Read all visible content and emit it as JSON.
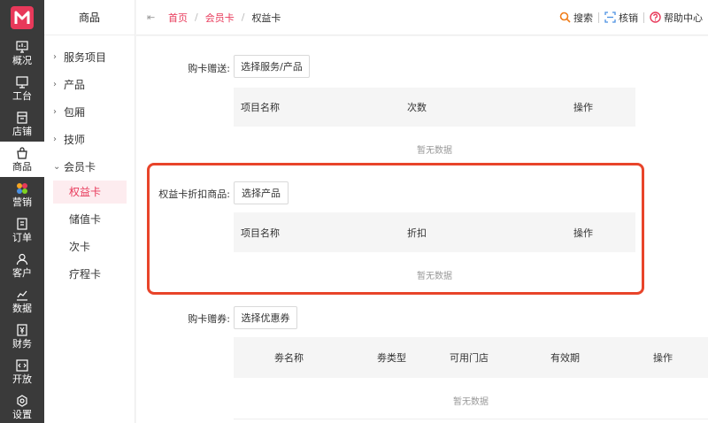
{
  "nav": {
    "items": [
      {
        "label": "概况",
        "icon": "monitor-chart-icon"
      },
      {
        "label": "工台",
        "icon": "desktop-icon"
      },
      {
        "label": "店铺",
        "icon": "store-icon"
      },
      {
        "label": "商品",
        "icon": "bag-icon"
      },
      {
        "label": "营销",
        "icon": "marketing-icon"
      },
      {
        "label": "订单",
        "icon": "order-icon"
      },
      {
        "label": "客户",
        "icon": "user-icon"
      },
      {
        "label": "数据",
        "icon": "data-icon"
      },
      {
        "label": "财务",
        "icon": "finance-icon"
      },
      {
        "label": "开放",
        "icon": "code-icon"
      },
      {
        "label": "设置",
        "icon": "settings-icon"
      }
    ]
  },
  "submenu": {
    "title": "商品",
    "groups": [
      "服务项目",
      "产品",
      "包厢",
      "技师",
      "会员卡"
    ],
    "leaves": [
      "权益卡",
      "储值卡",
      "次卡",
      "疗程卡"
    ]
  },
  "topbar": {
    "breadcrumb": [
      "首页",
      "会员卡",
      "权益卡"
    ],
    "search": "搜索",
    "verify": "核销",
    "help": "帮助中心"
  },
  "sections": {
    "gift": {
      "label": "购卡赠送:",
      "button": "选择服务/产品",
      "columns": [
        "项目名称",
        "次数",
        "操作"
      ],
      "empty": "暂无数据"
    },
    "discount": {
      "label": "权益卡折扣商品:",
      "button": "选择产品",
      "columns": [
        "项目名称",
        "折扣",
        "操作"
      ],
      "empty": "暂无数据"
    },
    "coupon": {
      "label": "购卡赠券:",
      "button": "选择优惠券",
      "columns": [
        "劵名称",
        "劵类型",
        "可用门店",
        "有效期",
        "操作"
      ],
      "empty": "暂无数据"
    }
  },
  "colors": {
    "accent": "#e8395a",
    "highlight": "#e8442a",
    "nav_bg": "#3a3a3a"
  }
}
